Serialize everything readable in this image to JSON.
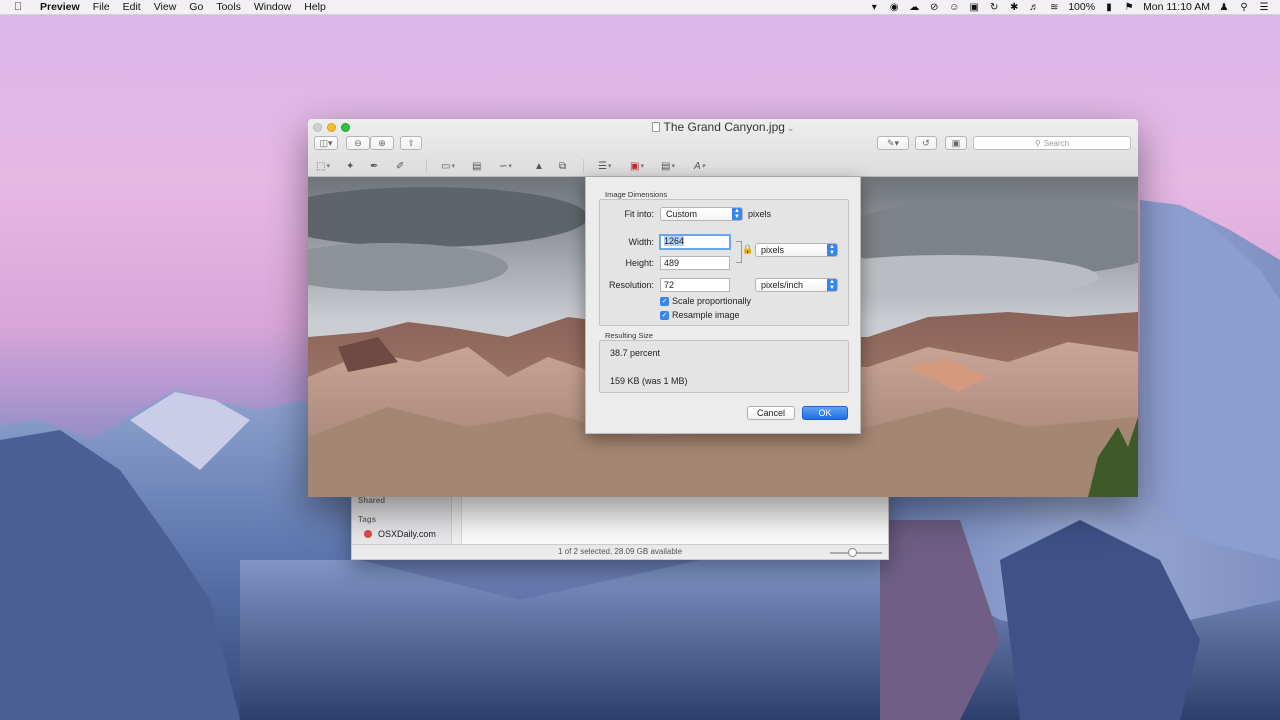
{
  "menubar": {
    "app": "Preview",
    "items": [
      "File",
      "Edit",
      "View",
      "Go",
      "Tools",
      "Window",
      "Help"
    ],
    "battery": "100%",
    "clock": "Mon 11:10 AM"
  },
  "window": {
    "title": "The Grand Canyon.jpg",
    "search_placeholder": "Search"
  },
  "dialog": {
    "dimensions_heading": "Image Dimensions",
    "fit_into_label": "Fit into:",
    "fit_into_value": "Custom",
    "fit_into_unit": "pixels",
    "width_label": "Width:",
    "width_value": "1264",
    "height_label": "Height:",
    "height_value": "489",
    "size_unit": "pixels",
    "resolution_label": "Resolution:",
    "resolution_value": "72",
    "resolution_unit": "pixels/inch",
    "scale_label": "Scale proportionally",
    "resample_label": "Resample image",
    "result_heading": "Resulting Size",
    "result_percent": "38.7 percent",
    "result_size": "159 KB (was 1 MB)",
    "cancel_label": "Cancel",
    "ok_label": "OK"
  },
  "finder": {
    "shared_heading": "Shared",
    "tags_heading": "Tags",
    "tag_item": "OSXDaily.com",
    "status": "1 of 2 selected, 28.09 GB available"
  }
}
